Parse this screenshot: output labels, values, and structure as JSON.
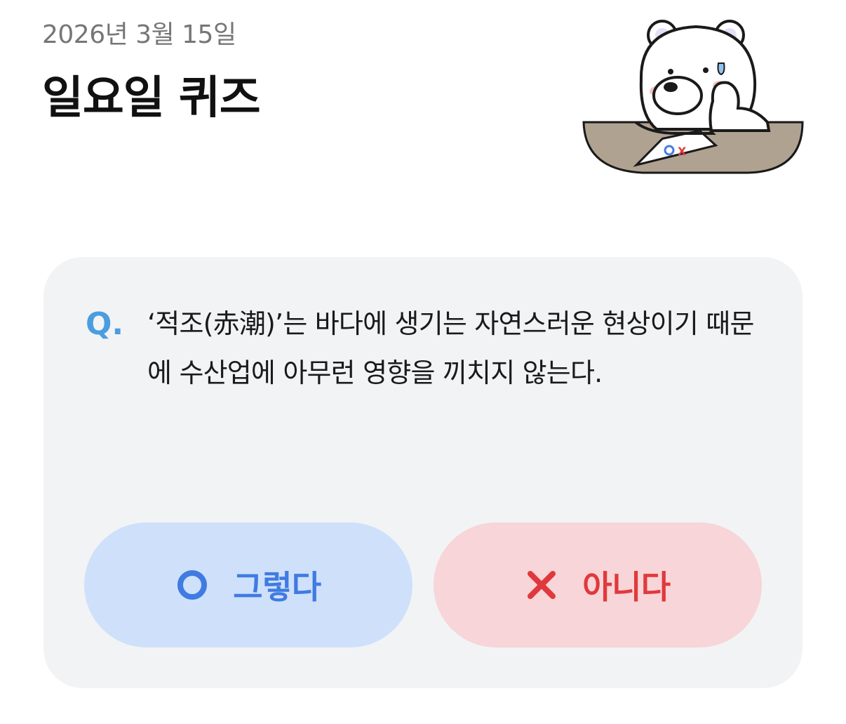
{
  "header": {
    "date": "2026년 3월 15일",
    "title": "일요일 퀴즈"
  },
  "illustration": {
    "icon": "polar-bear-thinking-icon",
    "card_o": "O",
    "card_x": "X"
  },
  "quiz": {
    "q_mark": "Q.",
    "question": "‘적조(赤潮)’는 바다에 생기는 자연스러운 현상이기 때문에 수산업에 아무런 영향을 끼치지 않는다."
  },
  "answers": {
    "yes": {
      "label": "그렇다",
      "icon": "circle-o-icon",
      "color": "#3f7be0",
      "bg": "#cfe0fb"
    },
    "no": {
      "label": "아니다",
      "icon": "x-mark-icon",
      "color": "#e0393d",
      "bg": "#f7d5d8"
    }
  },
  "colors": {
    "q_accent": "#4a9de0",
    "card_bg": "#f2f3f5",
    "desk": "#b0a291"
  }
}
